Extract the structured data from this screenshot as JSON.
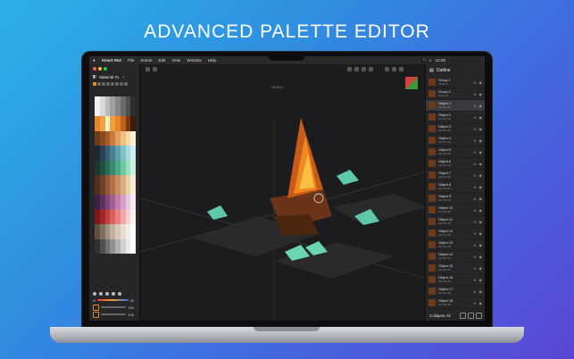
{
  "headline": "ADVANCED PALETTE EDITOR",
  "menubar": {
    "app_name": "Smart Mat",
    "items": [
      "File",
      "Scene",
      "Edit",
      "View",
      "Window",
      "Help"
    ],
    "clock": "12:00"
  },
  "left_panel": {
    "material_label": "Material #1",
    "tab_labels": [
      "1",
      "2",
      "3",
      "4",
      "5",
      "6",
      "7",
      "8"
    ],
    "slider_values": [
      "40",
      "100",
      "100"
    ]
  },
  "viewport": {
    "label": "OBJECT"
  },
  "outline": {
    "title": "Outline",
    "rows": [
      {
        "name": "Group 1",
        "sub": "18 items"
      },
      {
        "name": "Group 2",
        "sub": "18 items"
      },
      {
        "name": "Object 1",
        "sub": "32×32×48"
      },
      {
        "name": "Object 2",
        "sub": "32×32×48"
      },
      {
        "name": "Object 3",
        "sub": "32×32×48"
      },
      {
        "name": "Object 4",
        "sub": "32×32×48"
      },
      {
        "name": "Object 5",
        "sub": "32×32×48"
      },
      {
        "name": "Object 6",
        "sub": "32×32×48"
      },
      {
        "name": "Object 7",
        "sub": "32×32×48"
      },
      {
        "name": "Object 8",
        "sub": "32×32×48"
      },
      {
        "name": "Object 9",
        "sub": "32×32×48"
      },
      {
        "name": "Object 10",
        "sub": "32×32×48"
      },
      {
        "name": "Object 11",
        "sub": "32×32×48"
      },
      {
        "name": "Object 12",
        "sub": "32×32×48"
      },
      {
        "name": "Object 13",
        "sub": "32×32×48"
      },
      {
        "name": "Object 14",
        "sub": "32×32×48"
      },
      {
        "name": "Object 15",
        "sub": "32×32×48"
      },
      {
        "name": "Object 16",
        "sub": "32×32×48"
      },
      {
        "name": "Object 17",
        "sub": "32×32×48"
      },
      {
        "name": "Object 18",
        "sub": "32×32×48"
      }
    ],
    "collapse_label": "Collapse All"
  },
  "colors": {
    "accent": "#e3862a"
  }
}
